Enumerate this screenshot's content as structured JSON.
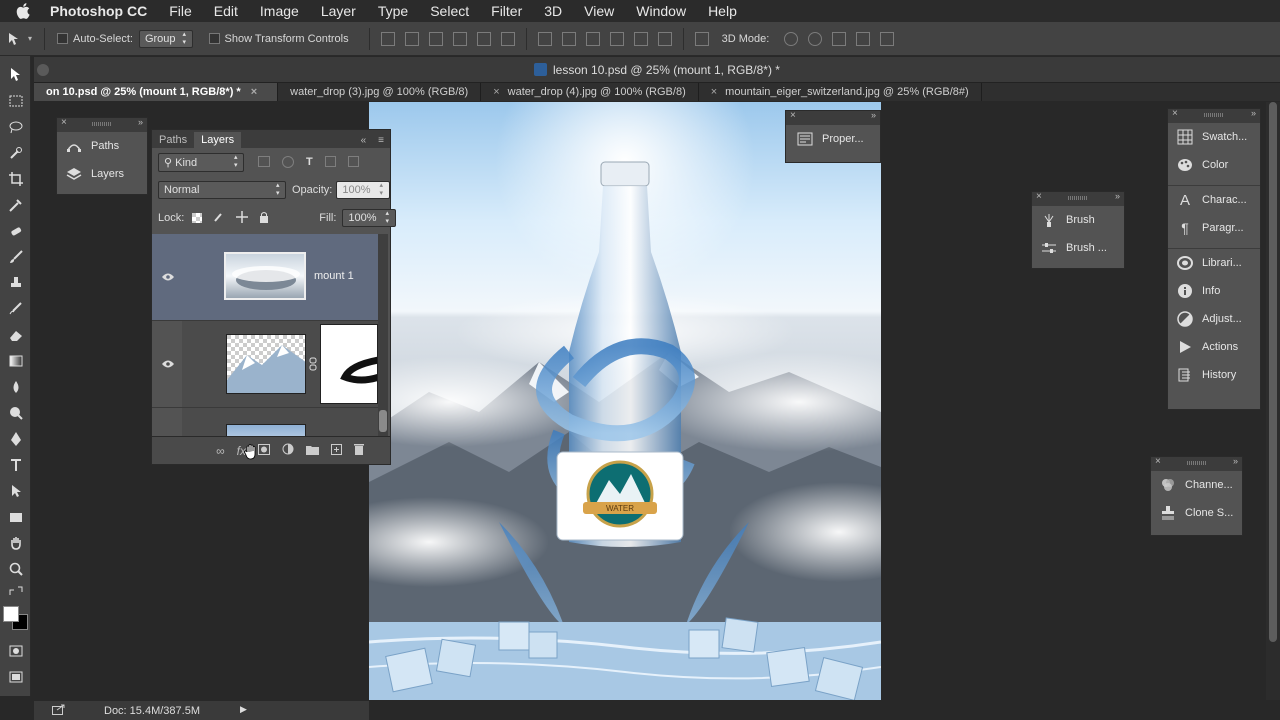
{
  "menubar": {
    "app": "Photoshop CC",
    "items": [
      "File",
      "Edit",
      "Image",
      "Layer",
      "Type",
      "Select",
      "Filter",
      "3D",
      "View",
      "Window",
      "Help"
    ]
  },
  "options": {
    "auto_select_label": "Auto-Select:",
    "auto_select_value": "Group",
    "show_transform_label": "Show Transform Controls",
    "mode_3d_label": "3D Mode:"
  },
  "document": {
    "title": "lesson 10.psd @ 25% (mount 1, RGB/8*) *",
    "tabs": [
      {
        "label": "on 10.psd @ 25% (mount 1, RGB/8*) *",
        "active": true
      },
      {
        "label": "water_drop (3).jpg @ 100% (RGB/8)",
        "active": false
      },
      {
        "label": "water_drop (4).jpg @ 100% (RGB/8)",
        "active": false
      },
      {
        "label": "mountain_eiger_switzerland.jpg @ 25% (RGB/8#)",
        "active": false
      }
    ]
  },
  "left_dock": {
    "paths": "Paths",
    "layers": "Layers"
  },
  "layers_panel": {
    "tab_paths": "Paths",
    "tab_layers": "Layers",
    "filter_kind": "Kind",
    "blend_mode": "Normal",
    "opacity_label": "Opacity:",
    "opacity_value": "100%",
    "lock_label": "Lock:",
    "fill_label": "Fill:",
    "fill_value": "100%",
    "layer_name_1": "mount 1",
    "fx_label": "fx"
  },
  "properties_panel": {
    "label": "Proper..."
  },
  "brush_panel": {
    "items": [
      "Brush",
      "Brush ..."
    ]
  },
  "right_dock": {
    "items": [
      "Swatch...",
      "Color",
      "Charac...",
      "Paragr...",
      "Librari...",
      "Info",
      "Adjust...",
      "Actions",
      "History"
    ]
  },
  "channels_panel": {
    "items": [
      "Channe...",
      "Clone S..."
    ]
  },
  "status": {
    "doc": "Doc: 15.4M/387.5M"
  },
  "label_art": {
    "text": "WATER"
  }
}
